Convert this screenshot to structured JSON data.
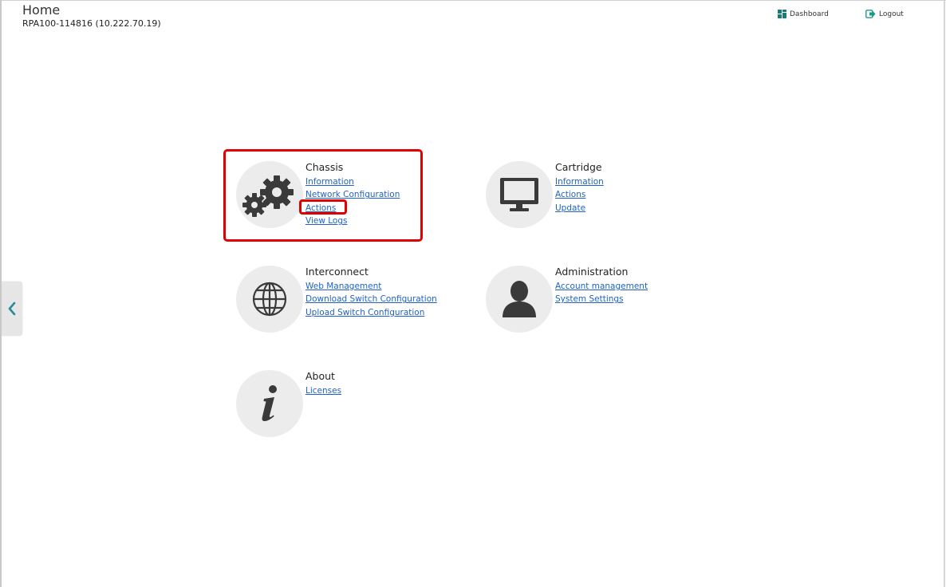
{
  "header": {
    "title": "Home",
    "subtitle": "RPA100-114816 (10.222.70.19)",
    "dashboard_label": "Dashboard",
    "logout_label": "Logout"
  },
  "groups": {
    "chassis": {
      "heading": "Chassis",
      "icon": "gears-icon",
      "links": [
        "Information",
        "Network Configuration",
        "Actions",
        "View Logs"
      ]
    },
    "cartridge": {
      "heading": "Cartridge",
      "icon": "monitor-icon",
      "links": [
        "Information",
        "Actions",
        "Update"
      ]
    },
    "interconnect": {
      "heading": "Interconnect",
      "icon": "globe-icon",
      "links": [
        "Web Management",
        "Download Switch Configuration",
        "Upload Switch Configuration"
      ]
    },
    "administration": {
      "heading": "Administration",
      "icon": "user-icon",
      "links": [
        "Account management",
        "System Settings"
      ]
    },
    "about": {
      "heading": "About",
      "icon": "info-icon",
      "links": [
        "Licenses"
      ]
    }
  },
  "colors": {
    "link": "#1f62c7",
    "icon": "#3a3a3a",
    "icon_bg": "#ececec",
    "highlight": "#e00000",
    "dashboard_icon": "#1a7a7a",
    "logout_icon": "#1a9a8a"
  }
}
